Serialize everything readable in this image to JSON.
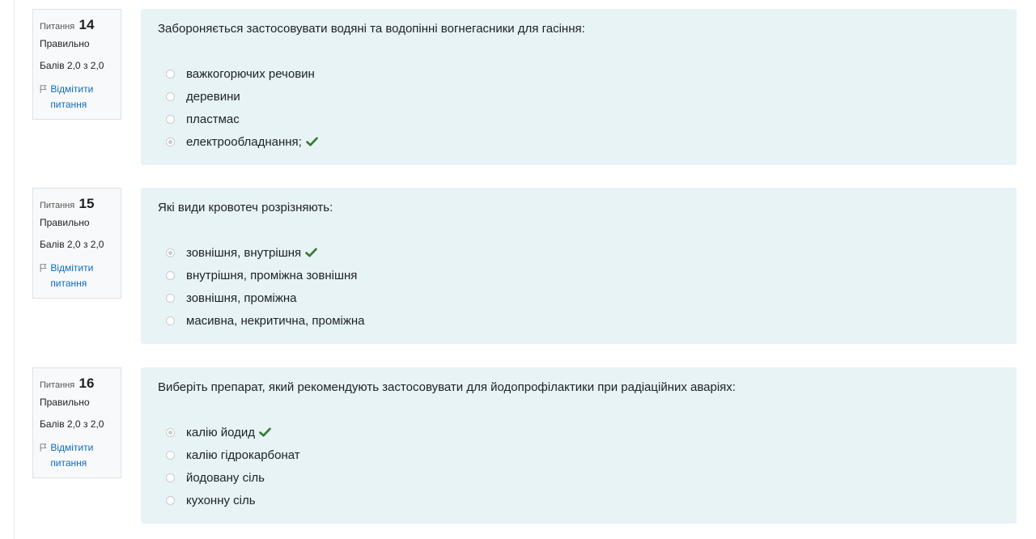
{
  "questions": [
    {
      "label": "Питання",
      "number": "14",
      "state": "Правильно",
      "grade": "Балів 2,0 з 2,0",
      "flag_label": "Відмітити питання",
      "text": "Забороняється застосовувати водяні та водопінні вогнегасники для гасіння:",
      "answers": [
        {
          "text": "важкогорючих речовин",
          "selected": false,
          "correct": false
        },
        {
          "text": "деревини",
          "selected": false,
          "correct": false
        },
        {
          "text": "пластмас",
          "selected": false,
          "correct": false
        },
        {
          "text": "електрообладнання;",
          "selected": true,
          "correct": true
        }
      ]
    },
    {
      "label": "Питання",
      "number": "15",
      "state": "Правильно",
      "grade": "Балів 2,0 з 2,0",
      "flag_label": "Відмітити питання",
      "text": "Які види кровотеч розрізняють:",
      "answers": [
        {
          "text": "зовнішня, внутрішня",
          "selected": true,
          "correct": true
        },
        {
          "text": "внутрішня, проміжна зовнішня",
          "selected": false,
          "correct": false
        },
        {
          "text": "зовнішня, проміжна",
          "selected": false,
          "correct": false
        },
        {
          "text": "масивна, некритична, проміжна",
          "selected": false,
          "correct": false
        }
      ]
    },
    {
      "label": "Питання",
      "number": "16",
      "state": "Правильно",
      "grade": "Балів 2,0 з 2,0",
      "flag_label": "Відмітити питання",
      "text": "Виберіть препарат, який рекомендують застосовувати для йодопрофілактики при радіаційних аваріях:",
      "answers": [
        {
          "text": "калію йодид",
          "selected": true,
          "correct": true
        },
        {
          "text": "калію гідрокарбонат",
          "selected": false,
          "correct": false
        },
        {
          "text": "йодовану сіль",
          "selected": false,
          "correct": false
        },
        {
          "text": "кухонну сіль",
          "selected": false,
          "correct": false
        }
      ]
    }
  ],
  "colors": {
    "content_bg": "#e7f3f5",
    "link": "#0f6cbf",
    "check": "#357a32"
  },
  "icons": {
    "flag": "flag-icon",
    "check": "check-icon"
  }
}
